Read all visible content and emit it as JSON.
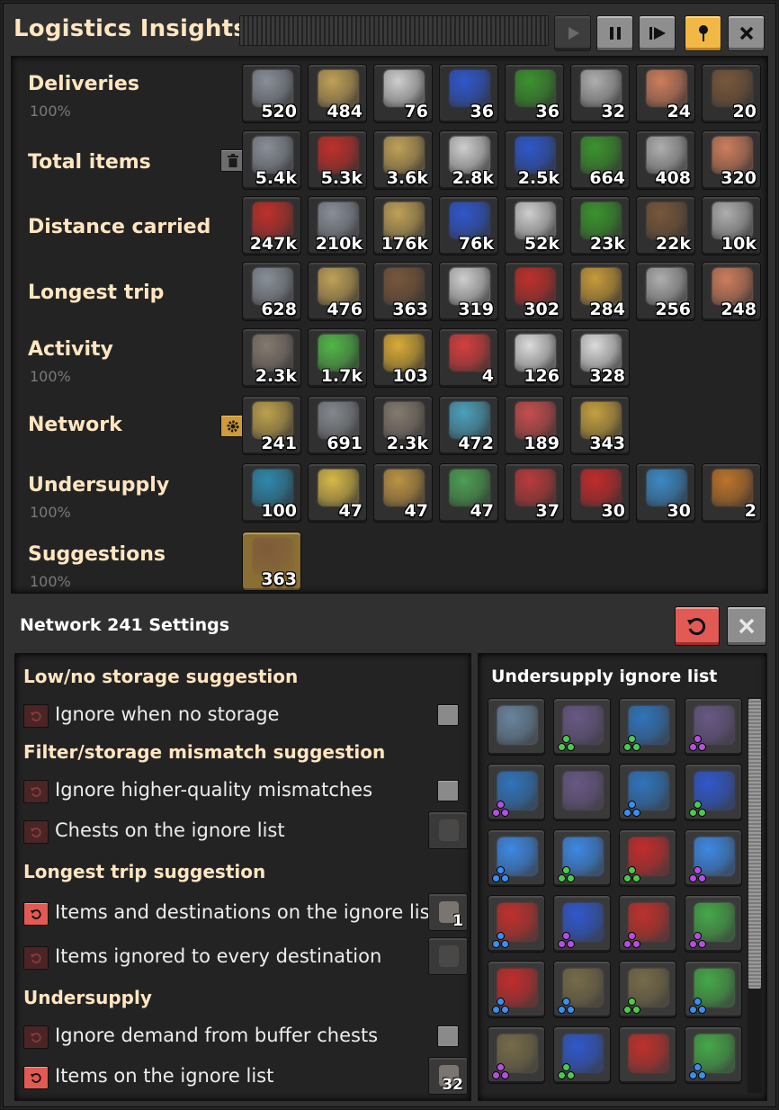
{
  "window": {
    "title": "Logistics Insights",
    "controls": [
      {
        "name": "play-button",
        "icon": "play-icon",
        "state": "disabled"
      },
      {
        "name": "pause-button",
        "icon": "pause-icon",
        "state": "normal"
      },
      {
        "name": "step-button",
        "icon": "step-forward-icon",
        "state": "normal"
      },
      {
        "name": "pin-button",
        "icon": "pin-icon",
        "state": "active"
      },
      {
        "name": "close-button",
        "icon": "close-icon",
        "state": "normal"
      }
    ]
  },
  "rows": [
    {
      "key": "deliveries",
      "label": "Deliveries",
      "sub": "100%",
      "button": null,
      "items": [
        {
          "icon": "iron-ore-icon",
          "count": "520",
          "color": "#8f96a0"
        },
        {
          "icon": "copper-ore-icon",
          "count": "484",
          "color": "#c9a95a"
        },
        {
          "icon": "iron-plate-icon",
          "count": "76",
          "color": "#d9d9d9"
        },
        {
          "icon": "advanced-circuit-icon",
          "count": "36",
          "color": "#2f5ad6"
        },
        {
          "icon": "electronic-circuit-icon",
          "count": "36",
          "color": "#3c9a2e"
        },
        {
          "icon": "steel-plate-icon",
          "count": "32",
          "color": "#b7b7b7"
        },
        {
          "icon": "copper-plate-icon",
          "count": "24",
          "color": "#d88360"
        },
        {
          "icon": "stone-icon",
          "count": "20",
          "color": "#7d5a3c"
        }
      ]
    },
    {
      "key": "total",
      "label": "Total items",
      "sub": "",
      "button": "trash-icon",
      "items": [
        {
          "icon": "iron-ore-icon",
          "count": "5.4k",
          "color": "#8f96a0"
        },
        {
          "icon": "processing-unit-icon",
          "count": "5.3k",
          "color": "#c8302b"
        },
        {
          "icon": "copper-ore-icon",
          "count": "3.6k",
          "color": "#c9a95a"
        },
        {
          "icon": "iron-plate-icon",
          "count": "2.8k",
          "color": "#d9d9d9"
        },
        {
          "icon": "advanced-circuit-icon",
          "count": "2.5k",
          "color": "#2f5ad6"
        },
        {
          "icon": "electronic-circuit-icon",
          "count": "664",
          "color": "#3c9a2e"
        },
        {
          "icon": "steel-plate-icon",
          "count": "408",
          "color": "#b7b7b7"
        },
        {
          "icon": "copper-plate-icon",
          "count": "320",
          "color": "#d88360"
        }
      ]
    },
    {
      "key": "distance",
      "label": "Distance carried",
      "sub": "",
      "button": null,
      "items": [
        {
          "icon": "processing-unit-icon",
          "count": "247k",
          "color": "#c8302b"
        },
        {
          "icon": "iron-ore-icon",
          "count": "210k",
          "color": "#8f96a0"
        },
        {
          "icon": "copper-ore-icon",
          "count": "176k",
          "color": "#c9a95a"
        },
        {
          "icon": "advanced-circuit-icon",
          "count": "76k",
          "color": "#2f5ad6"
        },
        {
          "icon": "iron-plate-icon",
          "count": "52k",
          "color": "#d9d9d9"
        },
        {
          "icon": "electronic-circuit-icon",
          "count": "23k",
          "color": "#3c9a2e"
        },
        {
          "icon": "stone-icon",
          "count": "22k",
          "color": "#7d5a3c"
        },
        {
          "icon": "steel-plate-icon",
          "count": "10k",
          "color": "#b7b7b7"
        }
      ]
    },
    {
      "key": "longest",
      "label": "Longest trip",
      "sub": "",
      "button": null,
      "items": [
        {
          "icon": "iron-ore-icon",
          "count": "628",
          "color": "#8f96a0"
        },
        {
          "icon": "copper-ore-icon",
          "count": "476",
          "color": "#c9a95a"
        },
        {
          "icon": "stone-icon",
          "count": "363",
          "color": "#7d5a3c"
        },
        {
          "icon": "iron-plate-icon",
          "count": "319",
          "color": "#d9d9d9"
        },
        {
          "icon": "processing-unit-icon",
          "count": "302",
          "color": "#c8302b"
        },
        {
          "icon": "battery-icon",
          "count": "284",
          "color": "#d1a23a"
        },
        {
          "icon": "steel-plate-icon",
          "count": "256",
          "color": "#b7b7b7"
        },
        {
          "icon": "copper-plate-icon",
          "count": "248",
          "color": "#d88360"
        }
      ]
    },
    {
      "key": "activity",
      "label": "Activity",
      "sub": "100%",
      "button": null,
      "items": [
        {
          "icon": "logistic-robot-icon",
          "count": "2.3k",
          "color": "#8a7f73"
        },
        {
          "icon": "battery-full-icon",
          "count": "1.7k",
          "color": "#54c04a"
        },
        {
          "icon": "battery-medium-icon",
          "count": "103",
          "color": "#e4b436"
        },
        {
          "icon": "battery-low-icon",
          "count": "4",
          "color": "#e04040"
        },
        {
          "icon": "enter-icon",
          "count": "126",
          "color": "#e8e8e8"
        },
        {
          "icon": "exit-icon",
          "count": "328",
          "color": "#e8e8e8"
        }
      ]
    },
    {
      "key": "network",
      "label": "Network",
      "sub": "",
      "button": "gear-icon",
      "items": [
        {
          "icon": "roboport-icon",
          "count": "241",
          "color": "#c6a94e"
        },
        {
          "icon": "construction-robot-icon",
          "count": "691",
          "color": "#8a8f94"
        },
        {
          "icon": "logistic-robot-icon",
          "count": "2.3k",
          "color": "#8a7f73"
        },
        {
          "icon": "requester-chest-icon",
          "count": "472",
          "color": "#4da8c4"
        },
        {
          "icon": "active-provider-chest-icon",
          "count": "189",
          "color": "#d05050"
        },
        {
          "icon": "storage-chest-icon",
          "count": "343",
          "color": "#cfa841"
        }
      ]
    },
    {
      "key": "undersupply",
      "label": "Undersupply",
      "sub": "100%",
      "button": null,
      "items": [
        {
          "icon": "lab-icon",
          "count": "100",
          "color": "#2d8fb5"
        },
        {
          "icon": "rocket-part-icon",
          "count": "47",
          "color": "#e2c34a"
        },
        {
          "icon": "inserter-icon",
          "count": "47",
          "color": "#c69a45"
        },
        {
          "icon": "assembler-icon",
          "count": "47",
          "color": "#4fa655"
        },
        {
          "icon": "assembler-red-icon",
          "count": "37",
          "color": "#c23c3c"
        },
        {
          "icon": "module-red-icon",
          "count": "30",
          "color": "#cc2b2b"
        },
        {
          "icon": "stack-inserter-icon",
          "count": "30",
          "color": "#3c8fd0"
        },
        {
          "icon": "power-armor-icon",
          "count": "2",
          "color": "#c7782a"
        }
      ]
    },
    {
      "key": "suggestions",
      "label": "Suggestions",
      "sub": "100%",
      "button": null,
      "items": [
        {
          "icon": "stone-icon",
          "count": "363",
          "color": "#7d5a3c",
          "selected": true
        }
      ]
    }
  ],
  "settings": {
    "title": "Network 241 Settings",
    "reset_icon": "reset-icon",
    "close_icon": "close-icon",
    "sections": [
      {
        "heading": "Low/no storage suggestion",
        "options": [
          {
            "label": "Ignore when no storage",
            "reset_active": false,
            "control": "checkbox"
          }
        ]
      },
      {
        "heading": "Filter/storage mismatch suggestion",
        "options": [
          {
            "label": "Ignore higher-quality mismatches",
            "reset_active": false,
            "control": "checkbox"
          },
          {
            "label": "Chests on the ignore list",
            "reset_active": false,
            "control": "slot",
            "slot_icon": "chest-icon",
            "slot_count": ""
          }
        ]
      },
      {
        "heading": "Longest trip suggestion",
        "options": [
          {
            "label": "Items and destinations on the ignore list",
            "reset_active": true,
            "control": "slot",
            "slot_icon": "robot-icon",
            "slot_count": "1"
          },
          {
            "label": "Items ignored to every destination",
            "reset_active": false,
            "control": "slot",
            "slot_icon": "robot-icon",
            "slot_count": ""
          }
        ]
      },
      {
        "heading": "Undersupply",
        "options": [
          {
            "label": "Ignore demand from buffer chests",
            "reset_active": false,
            "control": "checkbox"
          },
          {
            "label": "Items on the ignore list",
            "reset_active": true,
            "control": "slot",
            "slot_icon": "list-icon",
            "slot_count": "32"
          }
        ]
      }
    ],
    "ignore_list": {
      "title": "Undersupply ignore list",
      "items": [
        {
          "icon": "metallic-asteroid-chunk-icon",
          "color": "#6b8aa3",
          "quality": ""
        },
        {
          "icon": "tungsten-plate-icon",
          "color": "#6b5a8a",
          "quality": "#4ec84e"
        },
        {
          "icon": "quantum-processor-icon",
          "color": "#2f78c4",
          "quality": "#4ec84e"
        },
        {
          "icon": "tungsten-plate-icon",
          "color": "#6b5a8a",
          "quality": "#b54fe0"
        },
        {
          "icon": "quantum-processor-icon",
          "color": "#2f78c4",
          "quality": "#b54fe0"
        },
        {
          "icon": "tungsten-plate-icon",
          "color": "#6b5a8a",
          "quality": ""
        },
        {
          "icon": "quantum-processor-icon",
          "color": "#2f78c4",
          "quality": "#3c8ef0"
        },
        {
          "icon": "advanced-circuit-icon",
          "color": "#2f5ad6",
          "quality": "#4ec84e"
        },
        {
          "icon": "low-density-structure-icon",
          "color": "#3c8ef0",
          "quality": "#3c8ef0"
        },
        {
          "icon": "low-density-structure-icon",
          "color": "#3c8ef0",
          "quality": "#4ec84e"
        },
        {
          "icon": "module-red-icon",
          "color": "#cc2b2b",
          "quality": "#4ec84e"
        },
        {
          "icon": "low-density-structure-icon",
          "color": "#3c8ef0",
          "quality": "#b54fe0"
        },
        {
          "icon": "processing-unit-icon",
          "color": "#c8302b",
          "quality": "#3c8ef0"
        },
        {
          "icon": "advanced-circuit-icon",
          "color": "#2f5ad6",
          "quality": "#b54fe0"
        },
        {
          "icon": "processing-unit-icon",
          "color": "#c8302b",
          "quality": "#b54fe0"
        },
        {
          "icon": "module-green-icon",
          "color": "#46b04a",
          "quality": "#b54fe0"
        },
        {
          "icon": "module-red-icon",
          "color": "#cc2b2b",
          "quality": "#3c8ef0"
        },
        {
          "icon": "promethium-chunk-icon",
          "color": "#7a6f4a",
          "quality": "#3c8ef0"
        },
        {
          "icon": "promethium-chunk-icon",
          "color": "#7a6f4a",
          "quality": "#4ec84e"
        },
        {
          "icon": "module-green-icon",
          "color": "#46b04a",
          "quality": "#3c8ef0"
        },
        {
          "icon": "promethium-chunk-icon",
          "color": "#7a6f4a",
          "quality": "#b54fe0"
        },
        {
          "icon": "advanced-circuit-icon",
          "color": "#2f5ad6",
          "quality": "#4ec84e"
        },
        {
          "icon": "processing-unit-icon",
          "color": "#c8302b",
          "quality": ""
        },
        {
          "icon": "module-green-icon",
          "color": "#46b04a",
          "quality": "#3c8ef0"
        }
      ]
    }
  }
}
